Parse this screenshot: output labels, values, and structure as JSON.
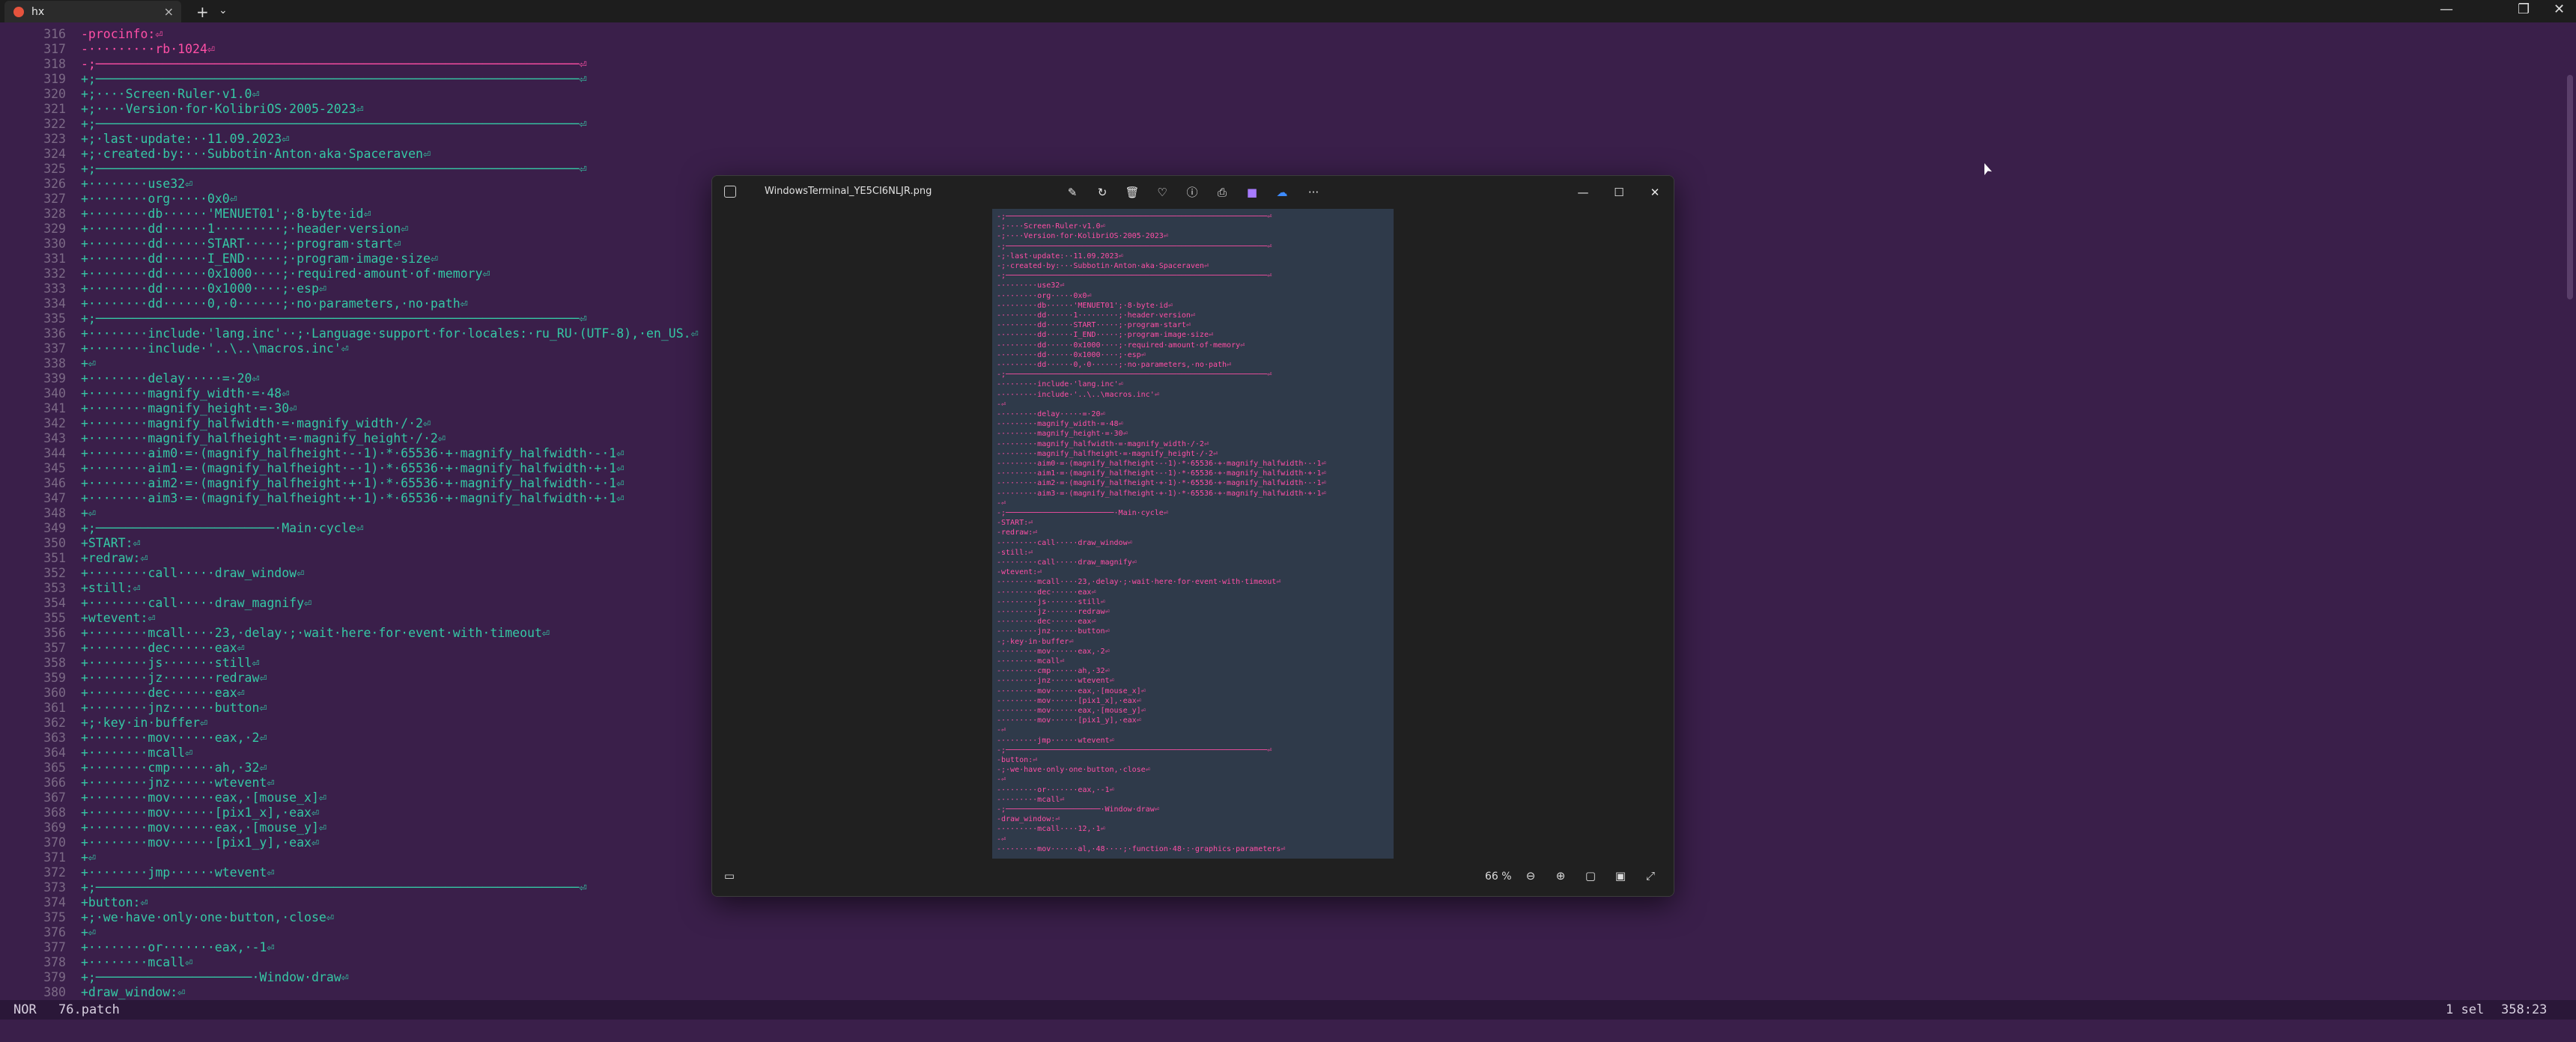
{
  "tab": {
    "title": "hx",
    "close": "×",
    "new": "+",
    "dropdown": "⌄"
  },
  "window_controls": {
    "minimize": "—",
    "maximize": "❐",
    "close": "✕"
  },
  "editor": {
    "lines": [
      {
        "n": "316",
        "t": "-procinfo:⏎",
        "mod": true
      },
      {
        "n": "317",
        "t": "-·········rb·1024⏎",
        "mod": true
      },
      {
        "n": "318",
        "t": "-;─────────────────────────────────────────────────────────────────⏎",
        "mod": true
      },
      {
        "n": "319",
        "t": "+;─────────────────────────────────────────────────────────────────⏎",
        "mod": false
      },
      {
        "n": "320",
        "t": "+;····Screen·Ruler·v1.0⏎",
        "mod": false
      },
      {
        "n": "321",
        "t": "+;····Version·for·KolibriOS·2005-2023⏎",
        "mod": false
      },
      {
        "n": "322",
        "t": "+;─────────────────────────────────────────────────────────────────⏎",
        "mod": false
      },
      {
        "n": "323",
        "t": "+;·last·update:··11.09.2023⏎",
        "mod": false
      },
      {
        "n": "324",
        "t": "+;·created·by:···Subbotin·Anton·aka·Spaceraven⏎",
        "mod": false
      },
      {
        "n": "325",
        "t": "+;─────────────────────────────────────────────────────────────────⏎",
        "mod": false
      },
      {
        "n": "326",
        "t": "+········use32⏎",
        "mod": false
      },
      {
        "n": "327",
        "t": "+········org·····0x0⏎",
        "mod": false
      },
      {
        "n": "328",
        "t": "+········db······'MENUET01';·8·byte·id⏎",
        "mod": false
      },
      {
        "n": "329",
        "t": "+········dd······1·········;·header·version⏎",
        "mod": false
      },
      {
        "n": "330",
        "t": "+········dd······START·····;·program·start⏎",
        "mod": false
      },
      {
        "n": "331",
        "t": "+········dd······I_END·····;·program·image·size⏎",
        "mod": false
      },
      {
        "n": "332",
        "t": "+········dd······0x1000····;·required·amount·of·memory⏎",
        "mod": false
      },
      {
        "n": "333",
        "t": "+········dd······0x1000····;·esp⏎",
        "mod": false
      },
      {
        "n": "334",
        "t": "+········dd······0,·0······;·no·parameters,·no·path⏎",
        "mod": false
      },
      {
        "n": "335",
        "t": "+;─────────────────────────────────────────────────────────────────⏎",
        "mod": false
      },
      {
        "n": "336",
        "t": "+········include·'lang.inc'··;·Language·support·for·locales:·ru_RU·(UTF-8),·en_US.⏎",
        "mod": false
      },
      {
        "n": "337",
        "t": "+········include·'..\\..\\macros.inc'⏎",
        "mod": false
      },
      {
        "n": "338",
        "t": "+⏎",
        "mod": false
      },
      {
        "n": "339",
        "t": "+········delay·····=·20⏎",
        "mod": false
      },
      {
        "n": "340",
        "t": "+········magnify_width·=·48⏎",
        "mod": false
      },
      {
        "n": "341",
        "t": "+········magnify_height·=·30⏎",
        "mod": false
      },
      {
        "n": "342",
        "t": "+········magnify_halfwidth·=·magnify_width·/·2⏎",
        "mod": false
      },
      {
        "n": "343",
        "t": "+········magnify_halfheight·=·magnify_height·/·2⏎",
        "mod": false
      },
      {
        "n": "344",
        "t": "+········aim0·=·(magnify_halfheight·-·1)·*·65536·+·magnify_halfwidth·-·1⏎",
        "mod": false
      },
      {
        "n": "345",
        "t": "+········aim1·=·(magnify_halfheight·-·1)·*·65536·+·magnify_halfwidth·+·1⏎",
        "mod": false
      },
      {
        "n": "346",
        "t": "+········aim2·=·(magnify_halfheight·+·1)·*·65536·+·magnify_halfwidth·-·1⏎",
        "mod": false
      },
      {
        "n": "347",
        "t": "+········aim3·=·(magnify_halfheight·+·1)·*·65536·+·magnify_halfwidth·+·1⏎",
        "mod": false
      },
      {
        "n": "348",
        "t": "+⏎",
        "mod": false
      },
      {
        "n": "349",
        "t": "+;────────────────────────·Main·cycle⏎",
        "mod": false
      },
      {
        "n": "350",
        "t": "+START:⏎",
        "mod": false
      },
      {
        "n": "351",
        "t": "+redraw:⏎",
        "mod": false
      },
      {
        "n": "352",
        "t": "+········call·····draw_window⏎",
        "mod": false
      },
      {
        "n": "353",
        "t": "+still:⏎",
        "mod": false
      },
      {
        "n": "354",
        "t": "+········call·····draw_magnify⏎",
        "mod": false
      },
      {
        "n": "355",
        "t": "+wtevent:⏎",
        "mod": false
      },
      {
        "n": "356",
        "t": "+········mcall····23,·delay·;·wait·here·for·event·with·timeout⏎",
        "mod": false
      },
      {
        "n": "357",
        "t": "+········dec······eax⏎",
        "mod": false
      },
      {
        "n": "358",
        "t": "+········js·······still⏎",
        "mod": false
      },
      {
        "n": "359",
        "t": "+········jz·······redraw⏎",
        "mod": false
      },
      {
        "n": "360",
        "t": "+········dec······eax⏎",
        "mod": false
      },
      {
        "n": "361",
        "t": "+········jnz······button⏎",
        "mod": false
      },
      {
        "n": "362",
        "t": "+;·key·in·buffer⏎",
        "mod": false
      },
      {
        "n": "363",
        "t": "+········mov······eax,·2⏎",
        "mod": false
      },
      {
        "n": "364",
        "t": "+········mcall⏎",
        "mod": false
      },
      {
        "n": "365",
        "t": "+········cmp······ah,·32⏎",
        "mod": false
      },
      {
        "n": "366",
        "t": "+········jnz······wtevent⏎",
        "mod": false
      },
      {
        "n": "367",
        "t": "+········mov······eax,·[mouse_x]⏎",
        "mod": false
      },
      {
        "n": "368",
        "t": "+········mov······[pix1_x],·eax⏎",
        "mod": false
      },
      {
        "n": "369",
        "t": "+········mov······eax,·[mouse_y]⏎",
        "mod": false
      },
      {
        "n": "370",
        "t": "+········mov······[pix1_y],·eax⏎",
        "mod": false
      },
      {
        "n": "371",
        "t": "+⏎",
        "mod": false
      },
      {
        "n": "372",
        "t": "+········jmp······wtevent⏎",
        "mod": false
      },
      {
        "n": "373",
        "t": "+;─────────────────────────────────────────────────────────────────⏎",
        "mod": false
      },
      {
        "n": "374",
        "t": "+button:⏎",
        "mod": false
      },
      {
        "n": "375",
        "t": "+;·we·have·only·one·button,·close⏎",
        "mod": false
      },
      {
        "n": "376",
        "t": "+⏎",
        "mod": false
      },
      {
        "n": "377",
        "t": "+········or·······eax,·-1⏎",
        "mod": false
      },
      {
        "n": "378",
        "t": "+········mcall⏎",
        "mod": false
      },
      {
        "n": "379",
        "t": "+;─────────────────────·Window·draw⏎",
        "mod": false
      },
      {
        "n": "380",
        "t": "+draw_window:⏎",
        "mod": false
      }
    ]
  },
  "status": {
    "mode": "NOR",
    "file": "76.patch",
    "selection": "1 sel",
    "position": "358:23"
  },
  "viewer": {
    "filename": "WindowsTerminal_YE5CI6NLJR.png",
    "zoom": "66 %",
    "toolbar_icons": [
      "edit-icon",
      "rotate-icon",
      "delete-icon",
      "favorite-icon",
      "info-icon",
      "print-icon",
      "designer-icon",
      "onedrive-icon",
      "more-icon"
    ],
    "more_label": "···",
    "window": {
      "minimize": "—",
      "maximize": "☐",
      "close": "✕"
    },
    "shot_lines": [
      "-;──────────────────────────────────────────────────────────⏎",
      "-;····Screen·Ruler·v1.0⏎",
      "-;····Version·for·KolibriOS·2005-2023⏎",
      "-;──────────────────────────────────────────────────────────⏎",
      "-;·last·update:··11.09.2023⏎",
      "-;·created·by:···Subbotin·Anton·aka·Spaceraven⏎",
      "-;──────────────────────────────────────────────────────────⏎",
      "-········use32⏎",
      "-········org·····0x0⏎",
      "-········db······'MENUET01';·8·byte·id⏎",
      "-········dd······1·········;·header·version⏎",
      "-········dd······START·····;·program·start⏎",
      "-········dd······I_END·····;·program·image·size⏎",
      "-········dd······0x1000····;·required·amount·of·memory⏎",
      "-········dd······0x1000····;·esp⏎",
      "-········dd······0,·0······;·no·parameters,·no·path⏎",
      "-;──────────────────────────────────────────────────────────⏎",
      "-········include·'lang.inc'⏎",
      "-········include·'..\\..\\macros.inc'⏎",
      "-⏎",
      "-········delay·····=·20⏎",
      "-········magnify_width·=·48⏎",
      "-········magnify_height·=·30⏎",
      "-········magnify_halfwidth·=·magnify_width·/·2⏎",
      "-········magnify_halfheight·=·magnify_height·/·2⏎",
      "-········aim0·=·(magnify_halfheight·-·1)·*·65536·+·magnify_halfwidth·-·1⏎",
      "-········aim1·=·(magnify_halfheight·-·1)·*·65536·+·magnify_halfwidth·+·1⏎",
      "-········aim2·=·(magnify_halfheight·+·1)·*·65536·+·magnify_halfwidth·-·1⏎",
      "-········aim3·=·(magnify_halfheight·+·1)·*·65536·+·magnify_halfwidth·+·1⏎",
      "-⏎",
      "-;────────────────────────·Main·cycle⏎",
      "-START:⏎",
      "-redraw:⏎",
      "-········call·····draw_window⏎",
      "-still:⏎",
      "-········call·····draw_magnify⏎",
      "-wtevent:⏎",
      "-········mcall····23,·delay·;·wait·here·for·event·with·timeout⏎",
      "-········dec······eax⏎",
      "-········js·······still⏎",
      "-········jz·······redraw⏎",
      "-········dec······eax⏎",
      "-········jnz······button⏎",
      "-;·key·in·buffer⏎",
      "-········mov······eax,·2⏎",
      "-········mcall⏎",
      "-········cmp······ah,·32⏎",
      "-········jnz······wtevent⏎",
      "-········mov······eax,·[mouse_x]⏎",
      "-········mov······[pix1_x],·eax⏎",
      "-········mov······eax,·[mouse_y]⏎",
      "-········mov······[pix1_y],·eax⏎",
      "-⏎",
      "-········jmp······wtevent⏎",
      "-;──────────────────────────────────────────────────────────⏎",
      "-button:⏎",
      "-;·we·have·only·one·button,·close⏎",
      "-⏎",
      "-········or·······eax,·-1⏎",
      "-········mcall⏎",
      "-;─────────────────────·Window·draw⏎",
      "-draw_window:⏎",
      "-········mcall····12,·1⏎",
      "-⏎",
      "-········mov······al,·48····;·function·48·:·graphics·parameters⏎"
    ]
  }
}
